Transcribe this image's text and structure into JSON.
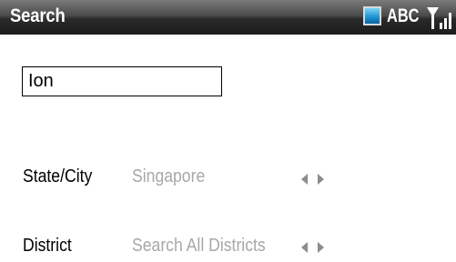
{
  "title_bar": {
    "title": "Search",
    "input_mode": "ABC",
    "icons": [
      "battery-icon",
      "signal-strength-icon"
    ]
  },
  "search": {
    "value": "Ion"
  },
  "fields": [
    {
      "label": "State/City",
      "value": "Singapore"
    },
    {
      "label": "District",
      "value": "Search All Districts"
    }
  ],
  "colors": {
    "title_bar": "#1c1c1c",
    "placeholder_value": "#a8a8a8",
    "arrow": "#8c8c8c"
  }
}
